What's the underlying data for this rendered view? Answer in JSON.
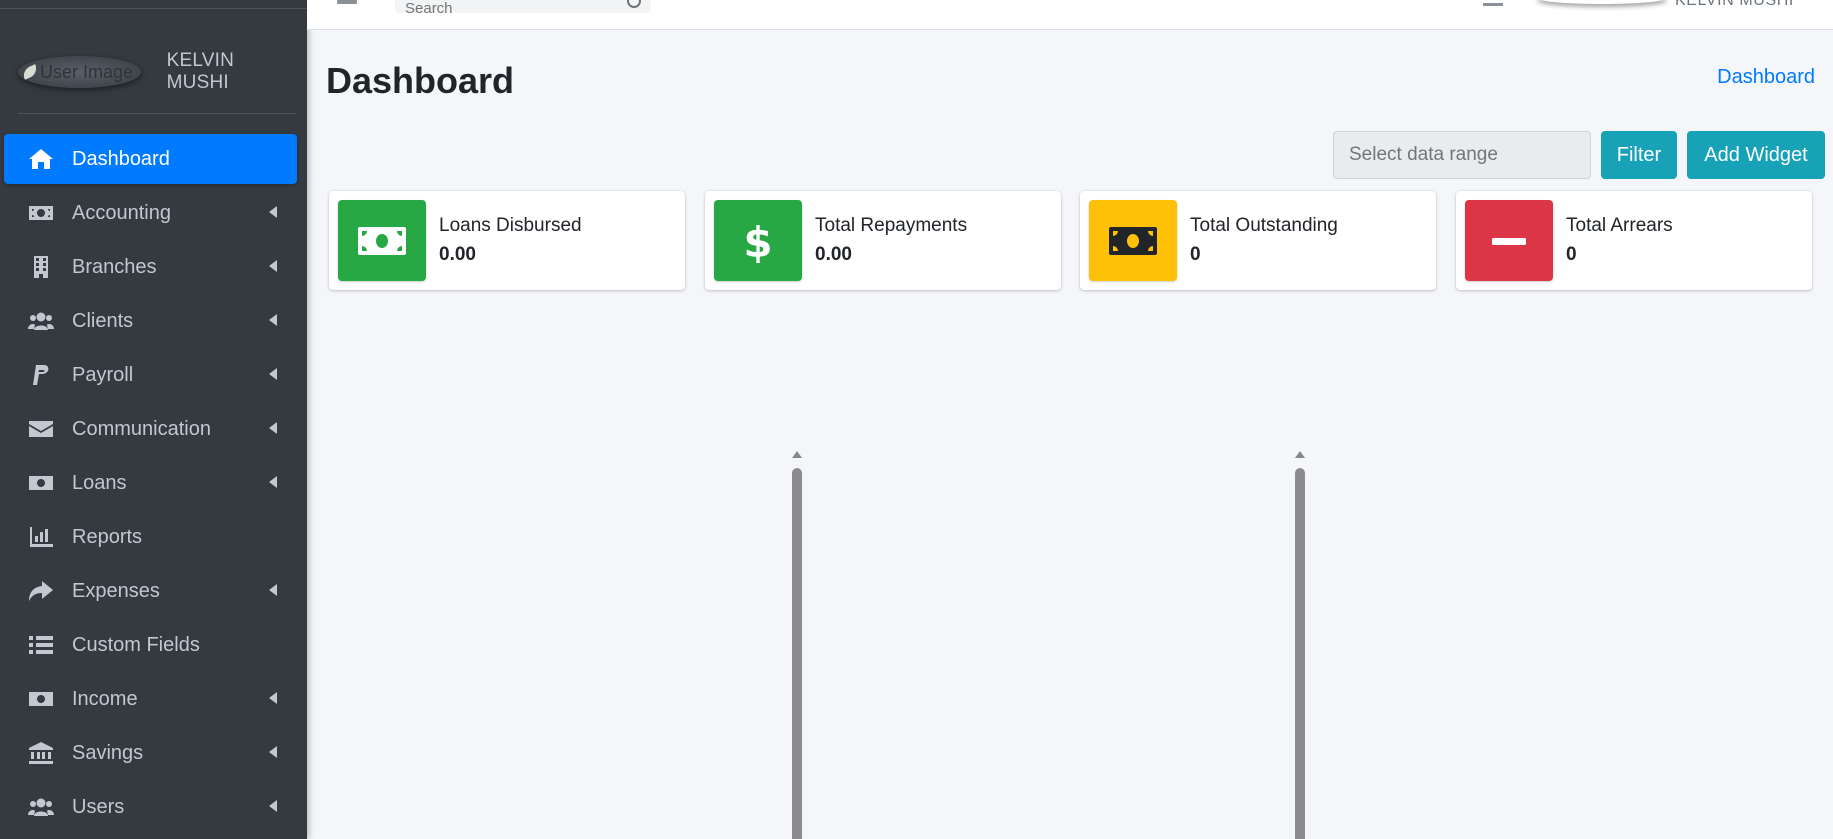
{
  "sidebar": {
    "user_name": "KELVIN MUSHI",
    "user_image_alt": "User Image",
    "items": [
      {
        "label": "Dashboard",
        "icon": "home-icon",
        "active": true,
        "has_arrow": false
      },
      {
        "label": "Accounting",
        "icon": "money-bill-icon",
        "active": false,
        "has_arrow": true
      },
      {
        "label": "Branches",
        "icon": "building-icon",
        "active": false,
        "has_arrow": true
      },
      {
        "label": "Clients",
        "icon": "users-icon",
        "active": false,
        "has_arrow": true
      },
      {
        "label": "Payroll",
        "icon": "paypal-icon",
        "active": false,
        "has_arrow": true
      },
      {
        "label": "Communication",
        "icon": "envelope-icon",
        "active": false,
        "has_arrow": true
      },
      {
        "label": "Loans",
        "icon": "money-bill-icon",
        "active": false,
        "has_arrow": true
      },
      {
        "label": "Reports",
        "icon": "chart-bar-icon",
        "active": false,
        "has_arrow": false
      },
      {
        "label": "Expenses",
        "icon": "share-icon",
        "active": false,
        "has_arrow": true
      },
      {
        "label": "Custom Fields",
        "icon": "list-icon",
        "active": false,
        "has_arrow": false
      },
      {
        "label": "Income",
        "icon": "money-bill-icon",
        "active": false,
        "has_arrow": true
      },
      {
        "label": "Savings",
        "icon": "bank-icon",
        "active": false,
        "has_arrow": true
      },
      {
        "label": "Users",
        "icon": "users-icon",
        "active": false,
        "has_arrow": true
      }
    ]
  },
  "topbar": {
    "search_placeholder": "Search",
    "user_name": "KELVIN MUSHI"
  },
  "header": {
    "title": "Dashboard",
    "breadcrumb": "Dashboard"
  },
  "toolbar": {
    "range_placeholder": "Select data range",
    "filter_label": "Filter",
    "add_widget_label": "Add Widget"
  },
  "info_boxes": [
    {
      "label": "Loans Disbursed",
      "value": "0.00",
      "color": "#28a745",
      "icon": "money-bill-icon"
    },
    {
      "label": "Total Repayments",
      "value": "0.00",
      "color": "#28a745",
      "icon": "dollar-icon"
    },
    {
      "label": "Total Outstanding",
      "value": "0",
      "color": "#ffc107",
      "icon": "money-bill-icon"
    },
    {
      "label": "Total Arrears",
      "value": "0",
      "color": "#dc3545",
      "icon": "minus-icon"
    }
  ],
  "colors": {
    "sidebar_bg": "#343a40",
    "active": "#007bff",
    "info": "#17a2b8"
  }
}
